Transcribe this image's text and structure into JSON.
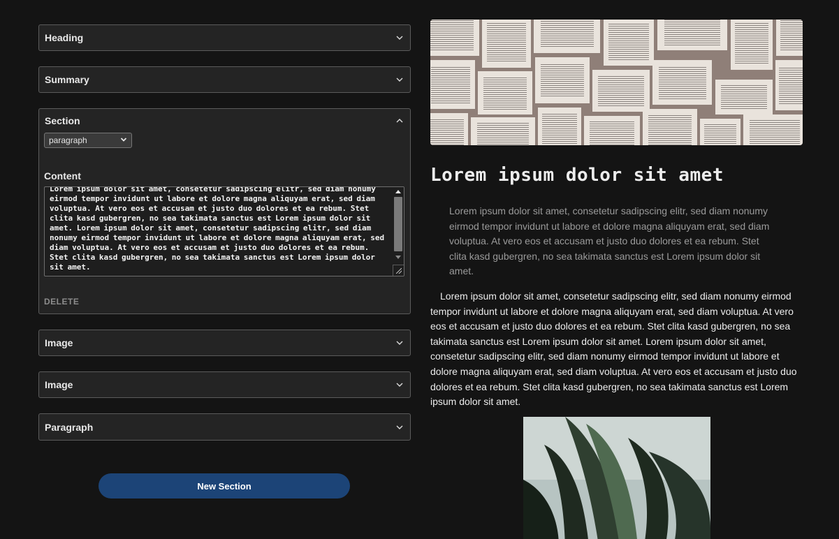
{
  "editor": {
    "panels": [
      {
        "title": "Heading"
      },
      {
        "title": "Summary"
      },
      {
        "title": "Section",
        "type_select_value": "paragraph",
        "content_label": "Content",
        "content_value": "Lorem ipsum dolor sit amet, consetetur sadipscing elitr, sed diam nonumy eirmod tempor invidunt ut labore et dolore magna aliquyam erat, sed diam voluptua. At vero eos et accusam et justo duo dolores et ea rebum. Stet clita kasd gubergren, no sea takimata sanctus est Lorem ipsum dolor sit amet. Lorem ipsum dolor sit amet, consetetur sadipscing elitr, sed diam nonumy eirmod tempor invidunt ut labore et dolore magna aliquyam erat, sed diam voluptua. At vero eos et accusam et justo duo dolores et ea rebum. Stet clita kasd gubergren, no sea takimata sanctus est Lorem ipsum dolor sit amet.",
        "delete_label": "DELETE"
      },
      {
        "title": "Image"
      },
      {
        "title": "Image"
      },
      {
        "title": "Paragraph"
      }
    ],
    "new_section_label": "New Section"
  },
  "preview": {
    "title": "Lorem ipsum dolor sit amet",
    "summary": "Lorem ipsum dolor sit amet, consetetur sadipscing elitr, sed diam nonumy eirmod tempor invidunt ut labore et dolore magna aliquyam erat, sed diam voluptua. At vero eos et accusam et justo duo dolores et ea rebum. Stet clita kasd gubergren, no sea takimata sanctus est Lorem ipsum dolor sit amet.",
    "paragraph": "Lorem ipsum dolor sit amet, consetetur sadipscing elitr, sed diam nonumy eirmod tempor invidunt ut labore et dolore magna aliquyam erat, sed diam voluptua. At vero eos et accusam et justo duo dolores et ea rebum. Stet clita kasd gubergren, no sea takimata sanctus est Lorem ipsum dolor sit amet. Lorem ipsum dolor sit amet, consetetur sadipscing elitr, sed diam nonumy eirmod tempor invidunt ut labore et dolore magna aliquyam erat, sed diam voluptua. At vero eos et accusam et justo duo dolores et ea rebum. Stet clita kasd gubergren, no sea takimata sanctus est Lorem ipsum dolor sit amet."
  },
  "colors": {
    "background": "#141414",
    "panel": "#242424",
    "accent_button": "#1c4477"
  },
  "icons": {
    "collapsed": "chevron-down-icon",
    "expanded": "chevron-up-icon"
  }
}
